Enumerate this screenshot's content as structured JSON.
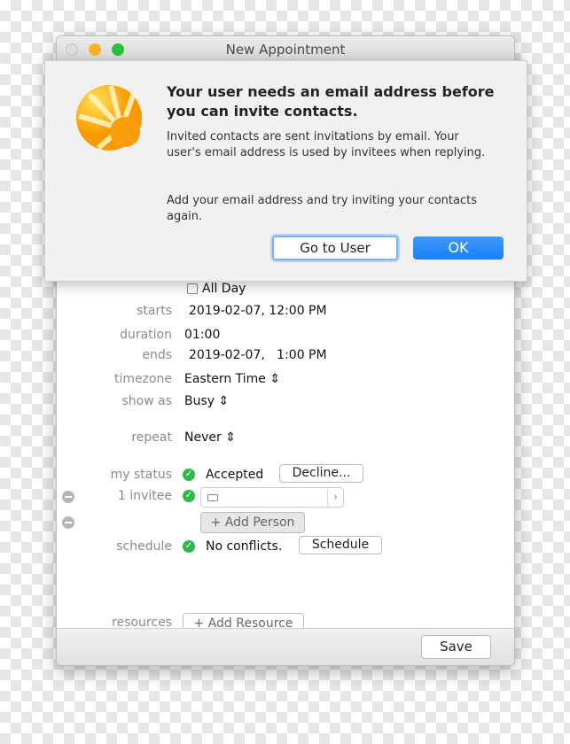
{
  "window": {
    "title": "New Appointment"
  },
  "form": {
    "all_day": "All Day",
    "starts_label": "starts",
    "starts_value": "2019-02-07, 12:00 PM",
    "duration_label": "duration",
    "duration_value": "01:00",
    "ends_label": "ends",
    "ends_value": "2019-02-07,   1:00 PM",
    "timezone_label": "timezone",
    "timezone_value": "Eastern Time",
    "showas_label": "show as",
    "showas_value": "Busy",
    "repeat_label": "repeat",
    "repeat_value": "Never",
    "mystatus_label": "my status",
    "mystatus_value": "Accepted",
    "decline_button": "Decline...",
    "invitee_label": "1 invitee",
    "add_person": "Add Person",
    "schedule_label": "schedule",
    "schedule_value": "No conflicts.",
    "schedule_button": "Schedule",
    "resources_label": "resources",
    "add_resource": "Add Resource"
  },
  "footer": {
    "save": "Save"
  },
  "alert": {
    "title": "Your user needs an email address before you can invite contacts.",
    "body1": "Invited contacts are sent invitations by email. Your user's email address is used by invitees when replying.",
    "body2": "Add your email address and try inviting your contacts again.",
    "go_to_user": "Go to User",
    "ok": "OK"
  },
  "colors": {
    "accent": "#1a82fb",
    "check": "#2eb84b"
  }
}
